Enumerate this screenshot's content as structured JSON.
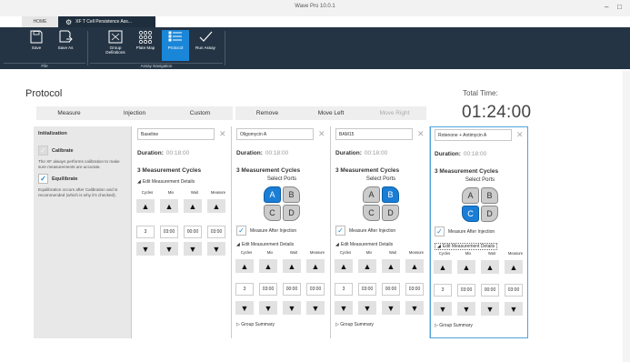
{
  "window": {
    "title": "Wave Pro 10.0.1",
    "minimize": "–",
    "maximize": "□"
  },
  "tabs": [
    {
      "label": "HOME"
    },
    {
      "label": "XF T Cell Persistence Ass..."
    }
  ],
  "ribbon": {
    "buttons": [
      {
        "label": "Save",
        "icon": "save-icon"
      },
      {
        "label": "Save As",
        "icon": "save-as-icon"
      },
      {
        "label": "Group Definitions",
        "icon": "group-definitions-icon"
      },
      {
        "label": "Plate Map",
        "icon": "plate-map-icon"
      },
      {
        "label": "Protocol",
        "icon": "protocol-icon",
        "selected": true
      },
      {
        "label": "Run Assay",
        "icon": "run-assay-icon"
      }
    ],
    "groups": [
      "File",
      "Assay Navigation"
    ]
  },
  "page": {
    "title": "Protocol",
    "total_time_label": "Total Time:",
    "total_time": "01:24:00"
  },
  "toolbar": {
    "measure": "Measure",
    "injection": "Injection",
    "custom": "Custom",
    "remove": "Remove",
    "move_left": "Move Left",
    "move_right": "Move Right"
  },
  "initialization": {
    "title": "Initialization",
    "calibrate": "Calibrate",
    "calibrate_note": "The XF always performs calibration to make sure measurements are accurate.",
    "equilibrate": "Equilibrate",
    "equilibrate_note": "Equilibration occurs after Calibration and is recommended (which is why it's checked)."
  },
  "labels": {
    "duration": "Duration:",
    "cycles_title": "3  Measurement Cycles",
    "select_ports": "Select Ports",
    "measure_after_injection": "Measure After Injection",
    "edit_details": "Edit Measurement Details",
    "group_summary": "Group Summary",
    "col_cycles": "Cycles",
    "col_mix": "Mix",
    "col_wait": "Wait",
    "col_measure": "Measure",
    "up": "▲",
    "down": "▼",
    "check": "✓",
    "close": "✕",
    "port_a": "A",
    "port_b": "B",
    "port_c": "C",
    "port_d": "D"
  },
  "steps": [
    {
      "name": "Baseline",
      "duration": "00:18:00",
      "cycles": "3",
      "mix": "03:00",
      "wait": "00:00",
      "measure": "03:00",
      "selected_port": null
    },
    {
      "name": "Oligomycin A",
      "duration": "00:18:00",
      "cycles": "3",
      "mix": "03:00",
      "wait": "00:00",
      "measure": "03:00",
      "selected_port": "A"
    },
    {
      "name": "BAM15",
      "duration": "00:18:00",
      "cycles": "3",
      "mix": "03:00",
      "wait": "00:00",
      "measure": "03:00",
      "selected_port": "B"
    },
    {
      "name": "Rotenone + Antimycin A",
      "duration": "00:18:00",
      "cycles": "3",
      "mix": "03:00",
      "wait": "00:00",
      "measure": "03:00",
      "selected_port": "C"
    }
  ],
  "colors": {
    "accent": "#1a86d8",
    "ribbon": "#243444",
    "tab_active": "#1f2e3c"
  }
}
